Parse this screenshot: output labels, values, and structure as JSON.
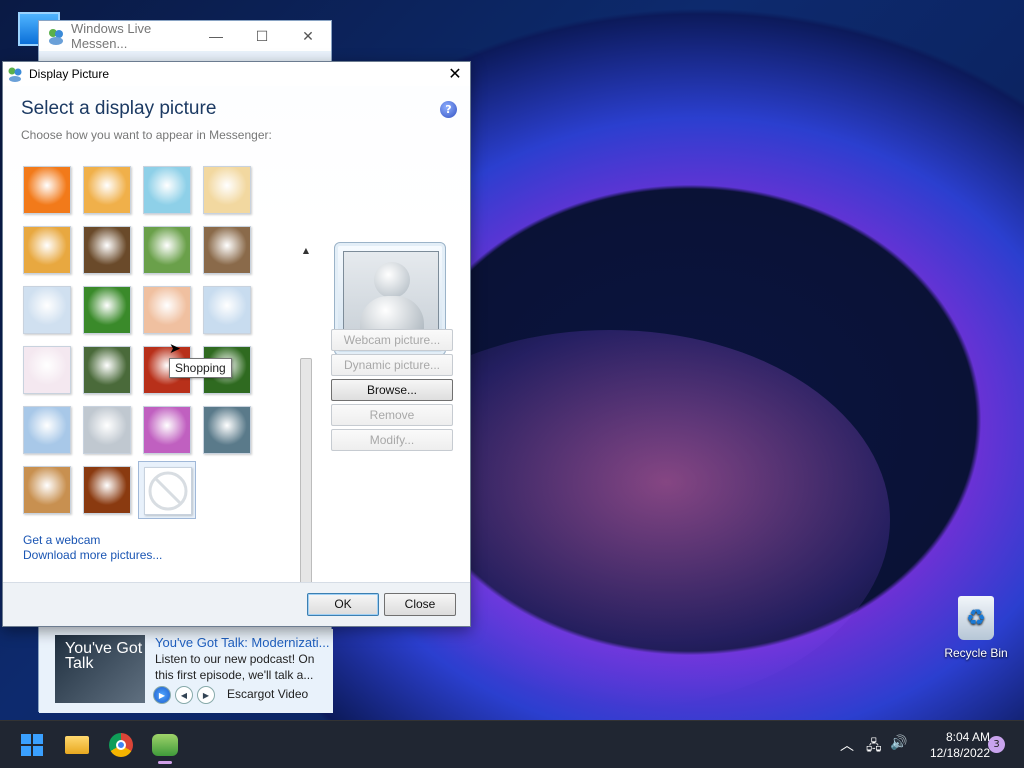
{
  "messenger_window": {
    "title": "Windows Live Messen...",
    "controls": [
      "—",
      "☐",
      "✕"
    ]
  },
  "ad": {
    "thumb_text": "You've Got Talk",
    "title": "You've Got Talk: Modernizati...",
    "description": "Listen to our new podcast! On this first episode, we'll talk a...",
    "source": "Escargot Video"
  },
  "dialog": {
    "title": "Display Picture",
    "close": "✕",
    "heading": "Select a display picture",
    "subheading": "Choose how you want to appear in Messenger:",
    "help": "?",
    "tooltip": "Shopping",
    "pictures": [
      {
        "name": "flower",
        "color": "#f27a1a"
      },
      {
        "name": "goldfish",
        "color": "#f0b04a"
      },
      {
        "name": "beach",
        "color": "#8ed0e8"
      },
      {
        "name": "buddy-yellow",
        "color": "#f2d8a0"
      },
      {
        "name": "bass-clef",
        "color": "#e8a840"
      },
      {
        "name": "chess",
        "color": "#6a4a2a"
      },
      {
        "name": "soccer-buddy",
        "color": "#6aa04a"
      },
      {
        "name": "cat",
        "color": "#8a6a4a"
      },
      {
        "name": "guitar-buddy",
        "color": "#d0e0f0"
      },
      {
        "name": "sports-balls",
        "color": "#3a8a2a"
      },
      {
        "name": "shopping",
        "color": "#f0c0a0"
      },
      {
        "name": "rock-buddy",
        "color": "#c8dcef"
      },
      {
        "name": "pink-buddy",
        "color": "#f4e8f0"
      },
      {
        "name": "boy",
        "color": "#4a6a3a"
      },
      {
        "name": "red-leaves",
        "color": "#b8301a"
      },
      {
        "name": "green-leaf",
        "color": "#2f6a20"
      },
      {
        "name": "snail-buddy",
        "color": "#a8c8e8"
      },
      {
        "name": "snow-buddy",
        "color": "#c0c8d0"
      },
      {
        "name": "flowers-buddy",
        "color": "#c060c0"
      },
      {
        "name": "robot",
        "color": "#5a7a8a"
      },
      {
        "name": "dog",
        "color": "#c89050"
      },
      {
        "name": "sparkles",
        "color": "#8a3a10"
      },
      {
        "name": "no-picture",
        "color": "#ffffff"
      }
    ],
    "buttons": {
      "webcam": "Webcam picture...",
      "dynamic": "Dynamic picture...",
      "browse": "Browse...",
      "remove": "Remove",
      "modify": "Modify..."
    },
    "links": {
      "webcam": "Get a webcam",
      "download": "Download more pictures..."
    },
    "ok": "OK",
    "close_button": "Close"
  },
  "desktop": {
    "recycle_bin": "Recycle Bin"
  },
  "taskbar": {
    "time": "8:04 AM",
    "date": "12/18/2022",
    "notifications": "3"
  }
}
